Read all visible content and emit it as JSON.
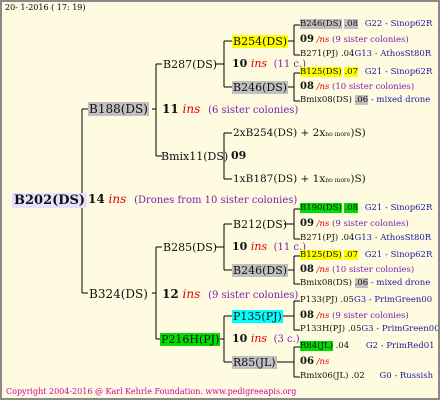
{
  "header_date": "20-  1-2016 ( 17: 19)",
  "footer": "Copyright 2004-2016 @ Karl Kehrle Foundation.   www.pedigreeapis.org",
  "colors": {
    "background": "#fffbe0",
    "gray_box": "#c0c0c0",
    "yellow_box": "#ffff00",
    "green_box": "#00dd00",
    "cyan_box": "#00ffff",
    "lavender_box": "#e6e0ff",
    "ins": "#e00000",
    "comment": "#7a1fb0"
  },
  "root": {
    "label": "B202(DS)",
    "num": "14",
    "ins": "ins",
    "note": "(Drones from 10 sister colonies)"
  },
  "gen1": [
    {
      "label": "B188(DS)",
      "num": "11",
      "ins": "ins",
      "note": "(6 sister colonies)"
    },
    {
      "label": "B324(DS)",
      "num": "12",
      "ins": "ins",
      "note": "(9 sister colonies)"
    }
  ],
  "gen2": [
    {
      "label": "B287(DS)",
      "num": "10",
      "ins": "ins",
      "note": "(11 c.)"
    },
    {
      "label": "Bmix11(DS)",
      "num": "09"
    },
    {
      "label": "B285(DS)",
      "num": "10",
      "ins": "ins",
      "note": "(11 c.)"
    },
    {
      "label": "P216H(PJ)",
      "num": "10",
      "ins": "ins",
      "note": "(3 c.)"
    }
  ],
  "gen3": [
    {
      "label": "B254(DS)"
    },
    {
      "label": "B246(DS)"
    },
    {
      "pre": "2xB254(DS) + 2x",
      "mid": "no more",
      "post": ")S)"
    },
    {
      "pre": "1xB187(DS) + 1x",
      "mid": "no more",
      "post": ")S)"
    },
    {
      "label": "B212(DS)"
    },
    {
      "label": "B246(DS)"
    },
    {
      "label": "P135(PJ)"
    },
    {
      "label": "R85(JL)"
    }
  ],
  "gen4": [
    {
      "a": "B246(DS)",
      "b": ".08",
      "c": "G22 - Sinop62R"
    },
    {
      "num": "09",
      "ins": "/ns",
      "note": "(9 sister colonies)"
    },
    {
      "a": "B271(PJ)",
      "b": ".04",
      "c": "G13 - AthosSt80R"
    },
    {
      "a": "B125(DS)",
      "b": ".07",
      "c": "G21 - Sinop62R"
    },
    {
      "num": "08",
      "ins": "/ns",
      "note": "(10 sister colonies)"
    },
    {
      "a": "Bmix08(DS)",
      "b": ".06",
      "c": "- mixed drone"
    },
    {
      "a": "B190(DS)",
      "b": ".08",
      "c": "G21 - Sinop62R"
    },
    {
      "num": "09",
      "ins": "/ns",
      "note": "(9 sister colonies)"
    },
    {
      "a": "B271(PJ)",
      "b": ".04",
      "c": "G13 - AthosSt80R"
    },
    {
      "a": "B125(DS)",
      "b": ".07",
      "c": "G21 - Sinop62R"
    },
    {
      "num": "08",
      "ins": "/ns",
      "note": "(10 sister colonies)"
    },
    {
      "a": "Bmix08(DS)",
      "b": ".06",
      "c": "- mixed drone"
    },
    {
      "a": "P133(PJ)",
      "b": ".05",
      "c": "G3 - PrimGreen00"
    },
    {
      "num": "08",
      "ins": "/ns",
      "note": "(9 sister colonies)"
    },
    {
      "a": "P133H(PJ)",
      "b": ".05",
      "c": "G3 - PrimGreen00"
    },
    {
      "a": "R84(JL)",
      "b": ".04",
      "c": "G2 - PrimRed01"
    },
    {
      "num": "06",
      "ins": "/ns",
      "note": ""
    },
    {
      "a": "Rmix06(JL)",
      "b": ".02",
      "c": "G0 - Russish"
    }
  ]
}
